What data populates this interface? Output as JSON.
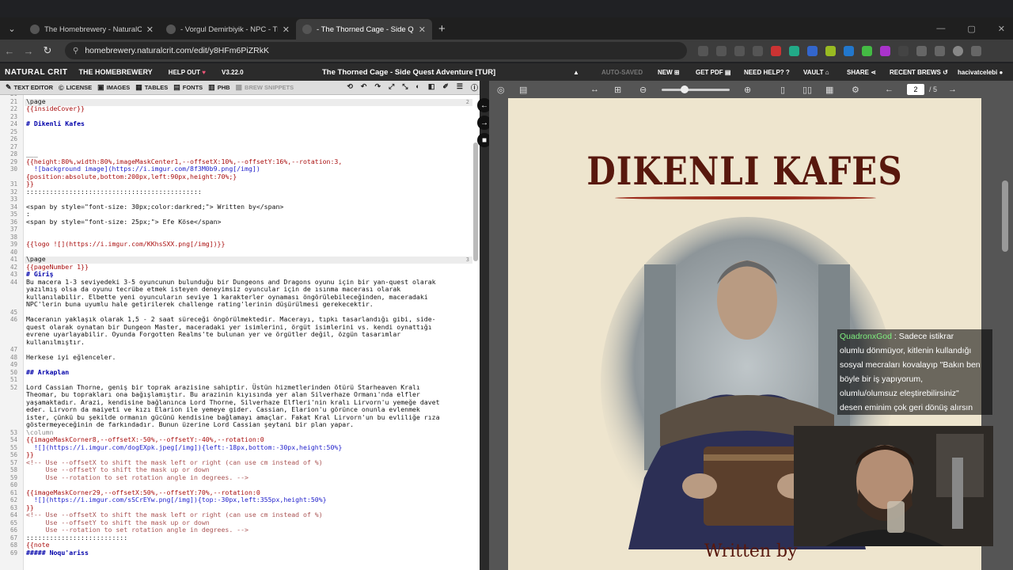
{
  "browser": {
    "tabs": [
      {
        "title": "The Homebrewery - NaturalCrit",
        "active": false
      },
      {
        "title": "- Vorgul Demirbiyik - NPC - The",
        "active": false
      },
      {
        "title": "- The Thorned Cage - Side Ques",
        "active": true
      }
    ],
    "url": "homebrewery.naturalcrit.com/edit/y8HFm6PiZRkK"
  },
  "app_nav": {
    "logo": "NATURAL CRIT",
    "brand": "THE HOMEBREWERY",
    "help_out": "HELP OUT",
    "version": "V3.22.0",
    "doc_title": "The Thorned Cage - Side Quest Adventure [TUR]",
    "auto_saved": "AUTO-SAVED",
    "new": "NEW",
    "get_pdf": "GET PDF",
    "need_help": "NEED HELP?",
    "vault": "VAULT",
    "share": "SHARE",
    "recent_brews": "RECENT BREWS",
    "username": "hacivatcelebi"
  },
  "editor_toolbar": {
    "items": [
      "TEXT EDITOR",
      "LICENSE",
      "IMAGES",
      "TABLES",
      "FONTS",
      "PHB",
      "BREW SNIPPETS"
    ]
  },
  "editor": {
    "lines": [
      {
        "n": "20",
        "t": "",
        "c": ""
      },
      {
        "n": "21",
        "t": "\\page",
        "c": ""
      },
      {
        "n": "22",
        "t": "{{insideCover}}",
        "c": "c-red"
      },
      {
        "n": "23",
        "t": "",
        "c": ""
      },
      {
        "n": "24",
        "t": "# Dikenli Kafes",
        "c": "c-head"
      },
      {
        "n": "25",
        "t": "",
        "c": ""
      },
      {
        "n": "26",
        "t": "",
        "c": ""
      },
      {
        "n": "27",
        "t": "",
        "c": ""
      },
      {
        "n": "28",
        "t": "___",
        "c": ""
      },
      {
        "n": "29",
        "t": "{{height:80%,width:80%,imageMaskCenter1,--offsetX:10%,--offsetY:16%,--rotation:3,",
        "c": "c-red"
      },
      {
        "n": "30",
        "t": "  ![background image](https://i.imgur.com/8f3M0b9.png[/img])",
        "c": "c-blue"
      },
      {
        "n": "",
        "t": "{position:absolute,bottom:200px,left:90px,height:70%;}",
        "c": "c-red"
      },
      {
        "n": "31",
        "t": "}}",
        "c": "c-red"
      },
      {
        "n": "32",
        "t": ":::::::::::::::::::::::::::::::::::::::::::::",
        "c": ""
      },
      {
        "n": "33",
        "t": "",
        "c": ""
      },
      {
        "n": "34",
        "t": "<span by style=\"font-size: 30px;color:darkred;\"> Written by</span>",
        "c": ""
      },
      {
        "n": "35",
        "t": ":",
        "c": ""
      },
      {
        "n": "36",
        "t": "<span by style=\"font-size: 25px;\"> Efe Köse</span>",
        "c": ""
      },
      {
        "n": "37",
        "t": "",
        "c": ""
      },
      {
        "n": "38",
        "t": "",
        "c": ""
      },
      {
        "n": "39",
        "t": "{{logo ![](https://i.imgur.com/KKhsSXX.png[/img])}}",
        "c": "c-red"
      },
      {
        "n": "40",
        "t": "",
        "c": ""
      },
      {
        "n": "41",
        "t": "\\page",
        "c": ""
      },
      {
        "n": "42",
        "t": "{{pageNumber 1}}",
        "c": "c-red"
      },
      {
        "n": "43",
        "t": "# Giriş",
        "c": "c-head"
      },
      {
        "n": "44",
        "t": "Bu macera 1-3 seviyedeki 3-5 oyuncunun bulunduğu bir Dungeons and Dragons oyunu için bir yan-quest olarak",
        "c": ""
      },
      {
        "n": "",
        "t": "yazılmış olsa da oyunu tecrübe etmek isteyen deneyimsiz oyuncular için de ısınma macerası olarak",
        "c": ""
      },
      {
        "n": "",
        "t": "kullanılabilir. Elbette yeni oyuncuların seviye 1 karakterler oynaması öngörülebileceğinden, maceradaki",
        "c": ""
      },
      {
        "n": "",
        "t": "NPC'lerin buna uyumlu hale getirilerek challenge rating'lerinin düşürülmesi gerekecektir.",
        "c": ""
      },
      {
        "n": "45",
        "t": "",
        "c": ""
      },
      {
        "n": "46",
        "t": "Maceranın yaklaşık olarak 1,5 - 2 saat süreceği öngörülmektedir. Macerayı, tıpkı tasarlandığı gibi, side-",
        "c": ""
      },
      {
        "n": "",
        "t": "quest olarak oynatan bir Dungeon Master, maceradaki yer isimlerini, örgüt isimlerini vs. kendi oynattığı",
        "c": ""
      },
      {
        "n": "",
        "t": "evrene uyarlayabilir. Oyunda Forgotten Realms'te bulunan yer ve örgütler değil, özgün tasarımlar",
        "c": ""
      },
      {
        "n": "",
        "t": "kullanılmıştır.",
        "c": ""
      },
      {
        "n": "47",
        "t": "",
        "c": ""
      },
      {
        "n": "48",
        "t": "Herkese iyi eğlenceler.",
        "c": ""
      },
      {
        "n": "49",
        "t": "",
        "c": ""
      },
      {
        "n": "50",
        "t": "## Arkaplan",
        "c": "c-head"
      },
      {
        "n": "51",
        "t": "",
        "c": ""
      },
      {
        "n": "52",
        "t": "Lord Cassian Thorne, geniş bir toprak arazisine sahiptir. Üstün hizmetlerinden ötürü Starheaven Kralı",
        "c": ""
      },
      {
        "n": "",
        "t": "Theomar, bu toprakları ona bağışlamıştır. Bu arazinin kıyısında yer alan Silverhaze Ormanı'nda elfler",
        "c": ""
      },
      {
        "n": "",
        "t": "yaşamaktadır. Arazi, kendisine bağlanınca Lord Thorne, Silverhaze Elfleri'nin kralı Lirvorn'u yemeğe davet",
        "c": ""
      },
      {
        "n": "",
        "t": "eder. Lirvorn da maiyeti ve kızı Elarion ile yemeye gider. Cassian, Elarion'u görünce onunla evlenmek",
        "c": ""
      },
      {
        "n": "",
        "t": "ister, çünkü bu şekilde ormanın gücünü kendisine bağlamayı amaçlar. Fakat Kral Lirvorn'un bu evliliğe rıza",
        "c": ""
      },
      {
        "n": "",
        "t": "göstermeyeceğinin de farkındadır. Bunun üzerine Lord Cassian şeytani bir plan yapar.",
        "c": ""
      },
      {
        "n": "53",
        "t": "\\column",
        "c": "c-grey"
      },
      {
        "n": "54",
        "t": "{{imageMaskCorner8,--offsetX:-50%,--offsetY:-40%,--rotation:0",
        "c": "c-red"
      },
      {
        "n": "55",
        "t": "  ![](https://i.imgur.com/dogEXpk.jpeg[/img]){left:-18px,bottom:-30px,height:50%}",
        "c": "c-blue"
      },
      {
        "n": "56",
        "t": "}}",
        "c": "c-red"
      },
      {
        "n": "57",
        "t": "<!-- Use --offsetX to shift the mask left or right (can use cm instead of %)",
        "c": "c-com"
      },
      {
        "n": "58",
        "t": "     Use --offsetY to shift the mask up or down",
        "c": "c-com"
      },
      {
        "n": "59",
        "t": "     Use --rotation to set rotation angle in degrees. -->",
        "c": "c-com"
      },
      {
        "n": "60",
        "t": "",
        "c": ""
      },
      {
        "n": "61",
        "t": "{{imageMaskCorner29,--offsetX:50%,--offsetY:70%,--rotation:0",
        "c": "c-red"
      },
      {
        "n": "62",
        "t": "  ![](https://i.imgur.com/sSCrEYw.png[/img]){top:-30px,left:355px,height:50%}",
        "c": "c-blue"
      },
      {
        "n": "63",
        "t": "}}",
        "c": "c-red"
      },
      {
        "n": "64",
        "t": "<!-- Use --offsetX to shift the mask left or right (can use cm instead of %)",
        "c": "c-com"
      },
      {
        "n": "65",
        "t": "     Use --offsetY to shift the mask up or down",
        "c": "c-com"
      },
      {
        "n": "66",
        "t": "     Use --rotation to set rotation angle in degrees. -->",
        "c": "c-com"
      },
      {
        "n": "67",
        "t": "::::::::::::::::::::::::::",
        "c": ""
      },
      {
        "n": "68",
        "t": "{{note",
        "c": "c-red"
      },
      {
        "n": "69",
        "t": "##### Noqu'ariss",
        "c": "c-head"
      }
    ],
    "page_markers": [
      "2",
      "3"
    ]
  },
  "preview": {
    "page_current": "2",
    "page_total": "/ 5",
    "page_title": "DIKENLI KAFES",
    "written_by": "Written by"
  },
  "stream_chat": {
    "user": "QuadronxGod",
    "lines": [
      ": Sadece istikrar",
      "olumlu dönmüyor, kitlenin kullandığı",
      "sosyal mecraları kovalayıp \"Bakın ben",
      "böyle bir iş yapıyorum,",
      "olumlu/olumsuz eleştirebilirsiniz\"",
      "desen eminim çok geri dönüş alırsın"
    ]
  }
}
